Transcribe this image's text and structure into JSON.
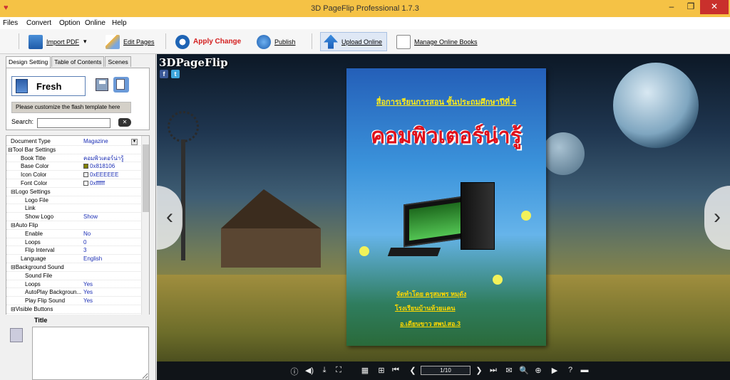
{
  "window": {
    "title": "3D PageFlip Professional 1.7.3",
    "minimize": "–",
    "restore": "❐",
    "close": "✕"
  },
  "menu": [
    "Files",
    "Convert",
    "Option",
    "Online",
    "Help"
  ],
  "toolbar": {
    "import_pdf": "Import PDF",
    "dropdown": "▾",
    "edit_pages": "Edit Pages",
    "apply_change": "Apply Change",
    "publish": "Publish",
    "upload_online": "Upload Online",
    "manage_online_books": "Manage Online Books"
  },
  "left_tabs": [
    "Design Setting",
    "Table of Contents",
    "Scenes"
  ],
  "design": {
    "template_name": "Fresh",
    "customize_label": "Please customize the flash template here",
    "search_label": "Search:",
    "search_value": ""
  },
  "properties": [
    {
      "key": "Document Type",
      "value": "Magazine",
      "indent": 1
    },
    {
      "key": "⊟Tool Bar Settings",
      "value": "",
      "indent": 0
    },
    {
      "key": "Book Title",
      "value": "คอมพิวเตอร์น่ารู้",
      "indent": 2
    },
    {
      "key": "Base Color",
      "value": "0x818106",
      "indent": 2,
      "swatch": "#818106"
    },
    {
      "key": "Icon Color",
      "value": "0xEEEEEE",
      "indent": 2,
      "swatch": "#EEEEEE"
    },
    {
      "key": "Font Color",
      "value": "0xffffff",
      "indent": 2,
      "swatch": "#ffffff"
    },
    {
      "key": "⊟Logo Settings",
      "value": "",
      "indent": 1
    },
    {
      "key": "Logo File",
      "value": "",
      "indent": 3
    },
    {
      "key": "Link",
      "value": "",
      "indent": 3
    },
    {
      "key": "Show Logo",
      "value": "Show",
      "indent": 3
    },
    {
      "key": "⊟Auto Flip",
      "value": "",
      "indent": 1
    },
    {
      "key": "Enable",
      "value": "No",
      "indent": 3
    },
    {
      "key": "Loops",
      "value": "0",
      "indent": 3
    },
    {
      "key": "Flip Interval",
      "value": "3",
      "indent": 3
    },
    {
      "key": "Language",
      "value": "English",
      "indent": 2
    },
    {
      "key": "⊟Background Sound",
      "value": "",
      "indent": 1
    },
    {
      "key": "Sound File",
      "value": "",
      "indent": 3
    },
    {
      "key": "Loops",
      "value": "Yes",
      "indent": 3
    },
    {
      "key": "AutoPlay Backgroun...",
      "value": "Yes",
      "indent": 3
    },
    {
      "key": "Play Flip Sound",
      "value": "Yes",
      "indent": 3
    },
    {
      "key": "⊟Visible Buttons",
      "value": "",
      "indent": 1
    }
  ],
  "title_section": {
    "label": "Title",
    "value": ""
  },
  "viewer": {
    "logo": "3DPageFlip",
    "facebook": "f",
    "twitter": "t",
    "prev": "‹",
    "next": "›",
    "page_indicator": "1/10",
    "book": {
      "subtitle": "สื่อการเรียนการสอน ชั้นประถมศึกษาปีที่ 4",
      "title": "คอมพิวเตอร์น่ารู้",
      "author": "จัดทำโดย ครูสมพร หมุดัง",
      "school": "โรงเรียนบ้านห้วยแคน",
      "district": "อ.เดียนขาว สพป.สอ.3"
    }
  },
  "bottom_icons": [
    "ⓘ",
    "◀)",
    "⤓",
    "⛶",
    "▦",
    "⊞",
    "⏮",
    "❮",
    "❯",
    "⏭",
    "✉",
    "🔍",
    "⊕",
    "▶",
    "?",
    "▬"
  ],
  "colors": {
    "titlebar": "#f5c245",
    "accent": "#1c2fb5",
    "close": "#c9302c"
  }
}
